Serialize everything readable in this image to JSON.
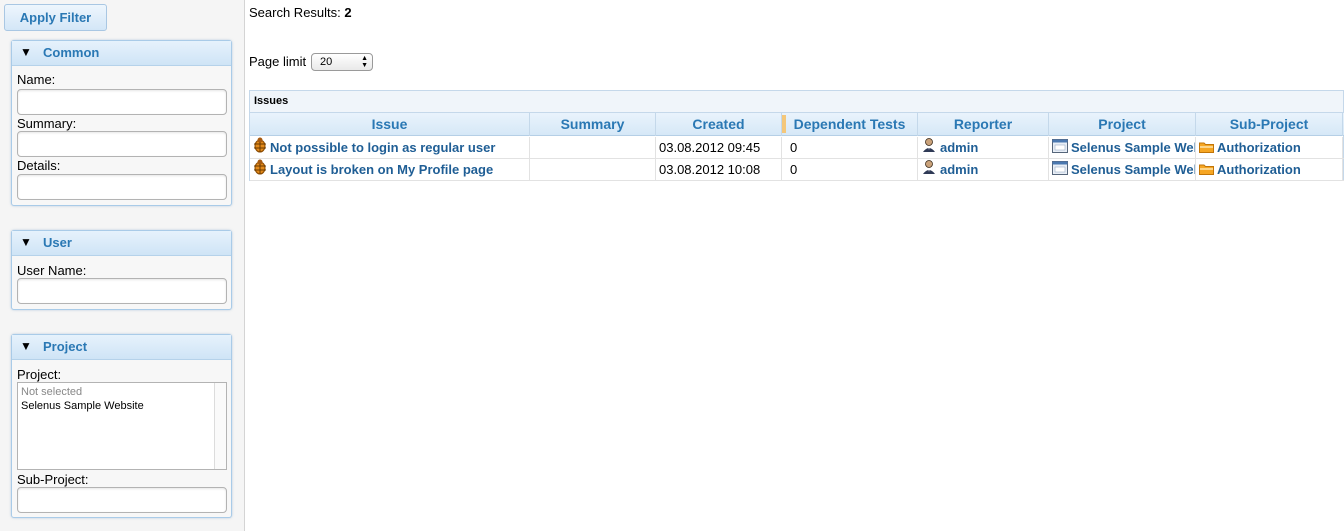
{
  "sidebar": {
    "apply_filter_label": "Apply Filter",
    "common": {
      "title": "Common",
      "name_label": "Name:",
      "summary_label": "Summary:",
      "details_label": "Details:"
    },
    "user": {
      "title": "User",
      "user_name_label": "User Name:"
    },
    "project": {
      "title": "Project",
      "project_label": "Project:",
      "project_options": [
        "Not selected",
        "Selenus Sample Website"
      ],
      "sub_project_label": "Sub-Project:"
    },
    "collapse_glyph": "▼"
  },
  "main": {
    "search_results_label": "Search Results:",
    "search_results_count": "2",
    "page_limit_label": "Page limit",
    "page_limit_value": "20",
    "grid": {
      "title": "Issues",
      "columns": [
        "Issue",
        "Summary",
        "Created",
        "Dependent Tests",
        "Reporter",
        "Project",
        "Sub-Project"
      ],
      "rows": [
        {
          "issue": "Not possible to login as regular user",
          "summary": "",
          "created": "03.08.2012 09:45",
          "dependent_tests": "0",
          "reporter": "admin",
          "project": "Selenus Sample Website",
          "sub_project": "Authorization"
        },
        {
          "issue": "Layout is broken on My Profile page",
          "summary": "",
          "created": "03.08.2012 10:08",
          "dependent_tests": "0",
          "reporter": "admin",
          "project": "Selenus Sample Website",
          "sub_project": "Authorization"
        }
      ]
    }
  },
  "colors": {
    "accent": "#2a78b4",
    "link": "#1f5e95",
    "panel_border": "#a9cbe8"
  },
  "icons": {
    "issue": "bug-icon",
    "reporter": "user-icon",
    "project": "window-icon",
    "sub_project": "folder-icon"
  }
}
